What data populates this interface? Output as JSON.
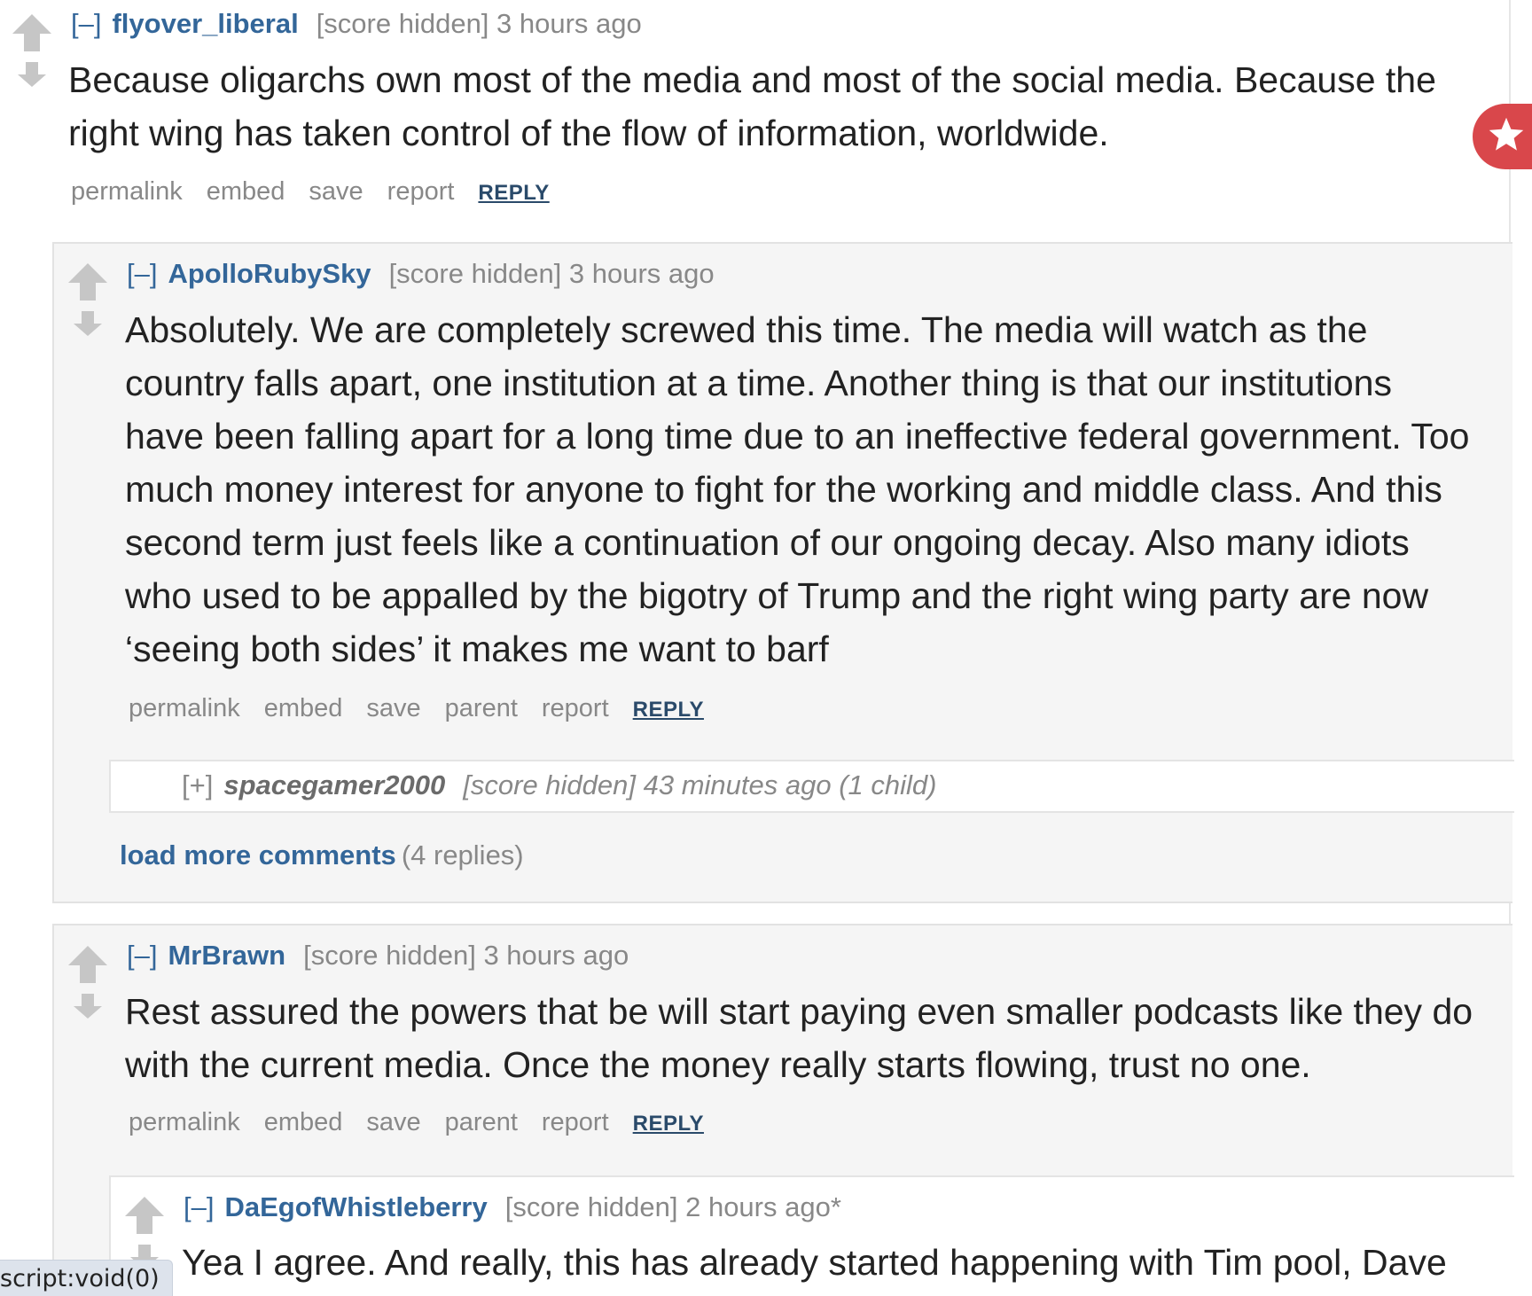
{
  "comments": [
    {
      "toggle": "[–]",
      "author": "flyover_liberal",
      "score": "[score hidden] 3 hours ago",
      "body": [
        "Because oligarchs own most of the media and most of the social media. Because the",
        "right wing has taken control of the flow of information, worldwide."
      ],
      "buttons": [
        "permalink",
        "embed",
        "save",
        "report"
      ],
      "reply": "REPLY"
    },
    {
      "toggle": "[–]",
      "author": "ApolloRubySky",
      "score": "[score hidden] 3 hours ago",
      "body": [
        "Absolutely. We are completely screwed this time. The media will watch as the",
        "country falls apart, one institution at a time. Another thing is that our institutions",
        "have been falling apart for a long time due to an ineffective federal government. Too",
        "much money interest for anyone to fight for the working and middle class. And this",
        "second term just feels like a continuation of our ongoing decay. Also many idiots",
        "who used to be appalled by the bigotry of Trump and the right wing party are now",
        "‘seeing both sides’ it makes me want to barf"
      ],
      "buttons": [
        "permalink",
        "embed",
        "save",
        "parent",
        "report"
      ],
      "reply": "REPLY"
    },
    {
      "toggle": "[+]",
      "author": "spacegamer2000",
      "score": "[score hidden] 43 minutes ago (1 child)"
    },
    {
      "toggle": "[–]",
      "author": "MrBrawn",
      "score": "[score hidden] 3 hours ago",
      "body": [
        "Rest assured the powers that be will start paying even smaller podcasts like they do",
        "with the current media. Once the money really starts flowing, trust no one."
      ],
      "buttons": [
        "permalink",
        "embed",
        "save",
        "parent",
        "report"
      ],
      "reply": "REPLY"
    },
    {
      "toggle": "[–]",
      "author": "DaEgofWhistleberry",
      "score": "[score hidden] 2 hours ago*",
      "body": [
        "Yea I agree. And really, this has already started happening with Tim pool, Dave"
      ]
    }
  ],
  "load_more": {
    "link": "load more comments",
    "count": "(4 replies)"
  },
  "status_bar": "script:void(0)",
  "colors": {
    "author": "#336699",
    "meta": "#888888",
    "nested_bg": "#f5f5f5",
    "badge": "#d9474b"
  }
}
